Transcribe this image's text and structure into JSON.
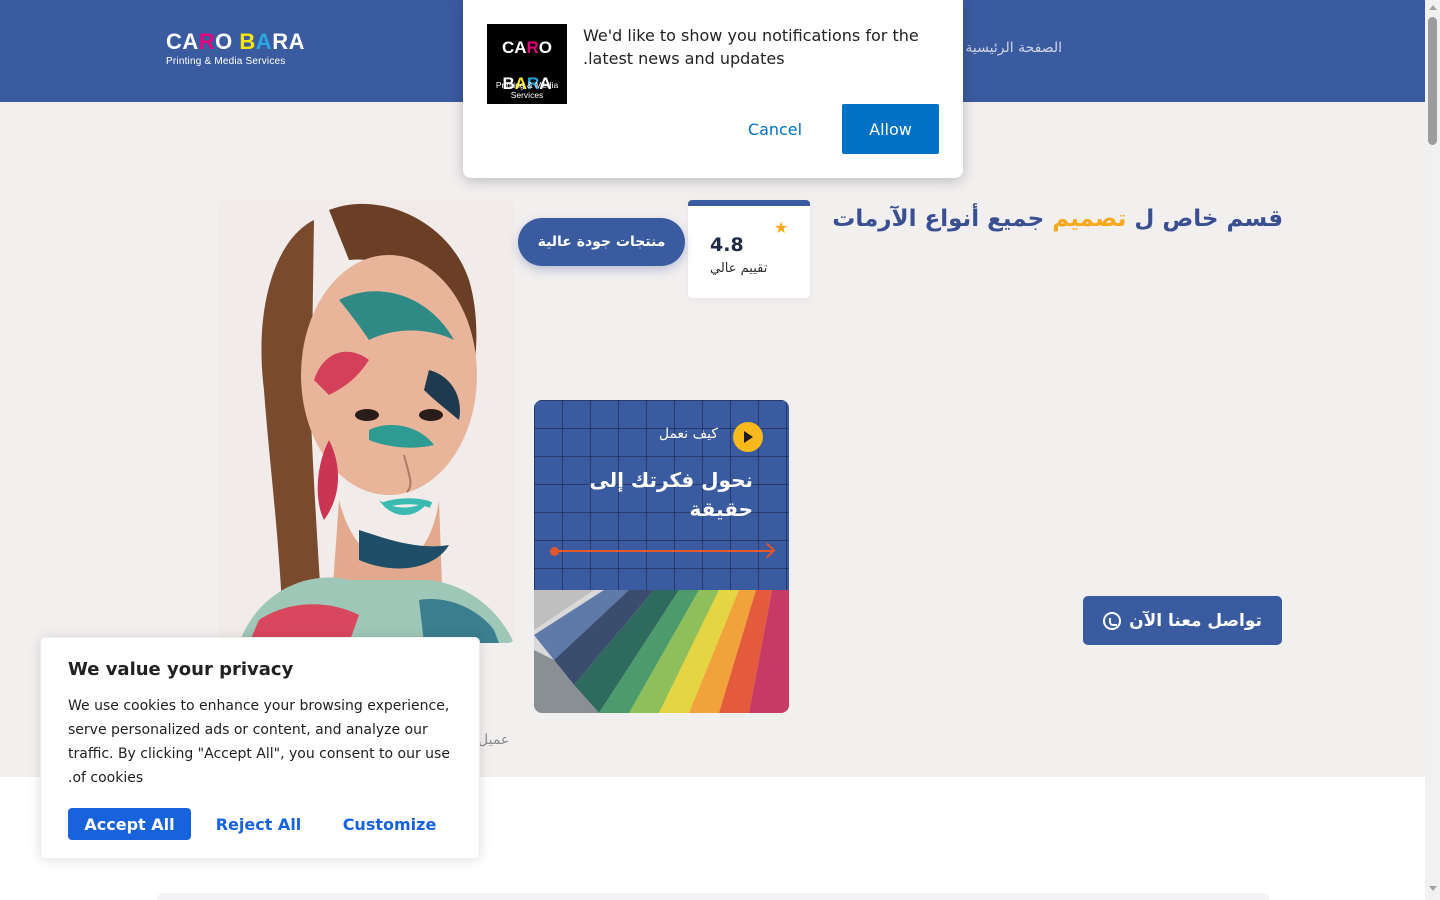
{
  "header": {
    "logo": {
      "main": [
        "CA",
        "R",
        "O",
        " B",
        "A",
        "RA"
      ],
      "sub": "Printing & Media Services"
    },
    "nav": {
      "home": "الصفحة الرئيسية"
    }
  },
  "hero": {
    "title_part1": "قسم خاص ل",
    "title_accent": "تصميم",
    "title_part2": "جميع أنواع الآرمات",
    "cta_label": "تواصل معنا الآن",
    "rating": {
      "value": "4.8",
      "label": "تقييم عالي"
    },
    "quality_badge": "منتجات جودة عالية",
    "clients_label": "عميل",
    "how_card": {
      "label": "كيف نعمل",
      "title": "نحول فكرتك إلى حقيقة"
    }
  },
  "notification": {
    "logo_main": "CARO BARA",
    "logo_sub": "Printing & Media Services",
    "message": "We'd like to show you notifications for the latest news and updates.",
    "cancel_label": "Cancel",
    "allow_label": "Allow"
  },
  "cookie": {
    "title": "We value your privacy",
    "text": "We use cookies to enhance your browsing experience, serve personalized ads or content, and analyze our traffic. By clicking \"Accept All\", you consent to our use of cookies.",
    "accept_label": "Accept All",
    "reject_label": "Reject All",
    "customize_label": "Customize"
  },
  "colors": {
    "brand_blue": "#3b5ba0",
    "accent_orange": "#f7a81b",
    "hero_bg": "#f2efef",
    "cookie_blue": "#1863dc",
    "notify_blue": "#0071c5"
  },
  "icons": [
    "whatsapp-icon",
    "star-icon",
    "play-icon",
    "arrow-right-icon"
  ]
}
